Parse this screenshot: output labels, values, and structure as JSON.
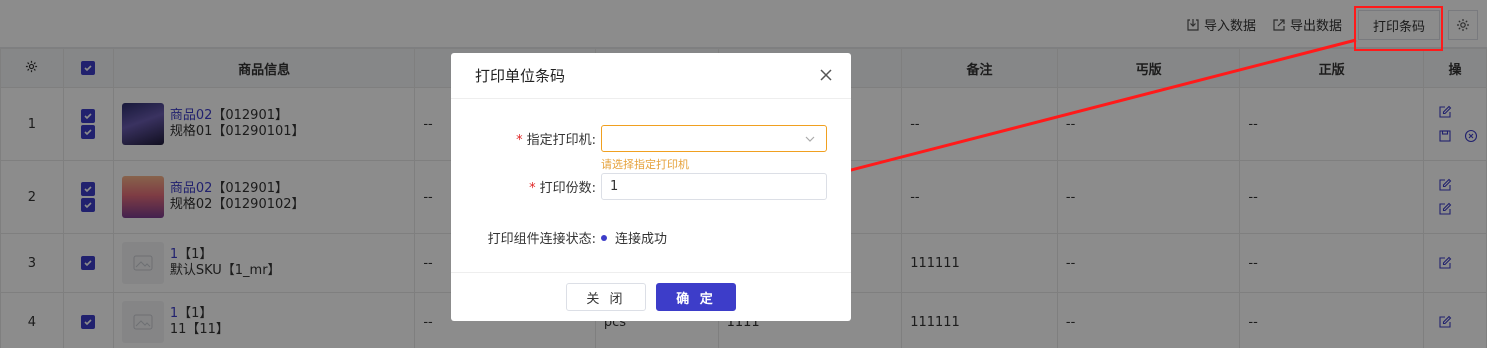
{
  "toolbar": {
    "import_label": "导入数据",
    "export_label": "导出数据",
    "print_barcode_label": "打印条码"
  },
  "table": {
    "headers": [
      "",
      "",
      "商品信息",
      "",
      "",
      "",
      "备注",
      "丐版",
      "正版",
      "操"
    ],
    "rows": [
      {
        "index": "1",
        "product_name": "商品02",
        "product_code": "【012901】",
        "sku_name": "规格01",
        "sku_code": "【01290101】",
        "col4": "--",
        "col5": "",
        "col6": "",
        "remark": "--",
        "budget": "--",
        "genuine": "--",
        "thumb": "a"
      },
      {
        "index": "2",
        "product_name": "商品02",
        "product_code": "【012901】",
        "sku_name": "规格02",
        "sku_code": "【01290102】",
        "col4": "--",
        "col5": "",
        "col6": "",
        "remark": "--",
        "budget": "--",
        "genuine": "--",
        "thumb": "b"
      },
      {
        "index": "3",
        "product_name": "1",
        "product_code": "【1】",
        "sku_name": "默认SKU",
        "sku_code": "【1_mr】",
        "col4": "--",
        "col5": "",
        "col6": "",
        "remark": "111111",
        "budget": "--",
        "genuine": "--",
        "thumb": "ph"
      },
      {
        "index": "4",
        "product_name": "1",
        "product_code": "【1】",
        "sku_name": "11",
        "sku_code": "【11】",
        "col4": "--",
        "col5": "pcs",
        "col6": "1111",
        "remark": "111111",
        "budget": "--",
        "genuine": "--",
        "thumb": "ph"
      }
    ]
  },
  "modal": {
    "title": "打印单位条码",
    "printer_label": "指定打印机:",
    "printer_value": "",
    "printer_error": "请选择指定打印机",
    "copies_label": "打印份数:",
    "copies_value": "1",
    "status_label": "打印组件连接状态:",
    "status_value": "连接成功",
    "cancel_label": "关 闭",
    "confirm_label": "确 定"
  },
  "colors": {
    "accent": "#3d3dc9",
    "annotation": "#ff1a1a",
    "warning": "#e6a23c"
  }
}
